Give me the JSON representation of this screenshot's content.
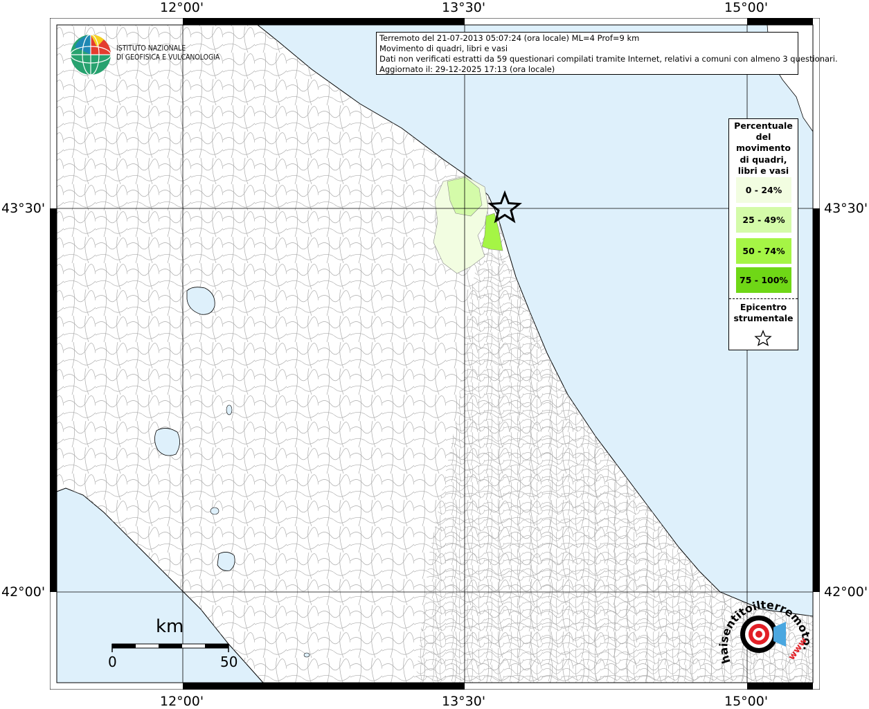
{
  "info": {
    "line1": "Terremoto del 21-07-2013 05:07:24 (ora locale) ML=4 Prof=9 km",
    "line2": "Movimento di quadri, libri e vasi",
    "line3": "Dati non verificati estratti da 59 questionari compilati tramite Internet, relativi a comuni con almeno 3 questionari.",
    "line4": "Aggiornato il: 29-12-2025 17:13 (ora locale)"
  },
  "logo": {
    "line1": "ISTITUTO NAZIONALE",
    "line2": "DI GEOFISICA E VULCANOLOGIA"
  },
  "axes": {
    "lon_labels": [
      "12°00'",
      "13°30'",
      "15°00'"
    ],
    "lat_labels": [
      "43°30'",
      "42°00'"
    ]
  },
  "legend": {
    "title": [
      "Percentuale",
      "del",
      "movimento",
      "di quadri,",
      "libri e vasi"
    ],
    "classes": [
      {
        "label": "0 - 24%",
        "color": "#f2fde1"
      },
      {
        "label": "25 - 49%",
        "color": "#d4fba9"
      },
      {
        "label": "50 - 74%",
        "color": "#a5f545"
      },
      {
        "label": "75 - 100%",
        "color": "#6fd716"
      }
    ],
    "epicenter_lines": [
      "Epicentro",
      "strumentale"
    ]
  },
  "scale": {
    "unit": "km",
    "min": "0",
    "max": "50"
  },
  "colors": {
    "sea": "#def0fb",
    "land": "#ffffff",
    "border": "#000000"
  },
  "watermark": {
    "text": "haisentitoilterremoto.it",
    "url": "www"
  }
}
